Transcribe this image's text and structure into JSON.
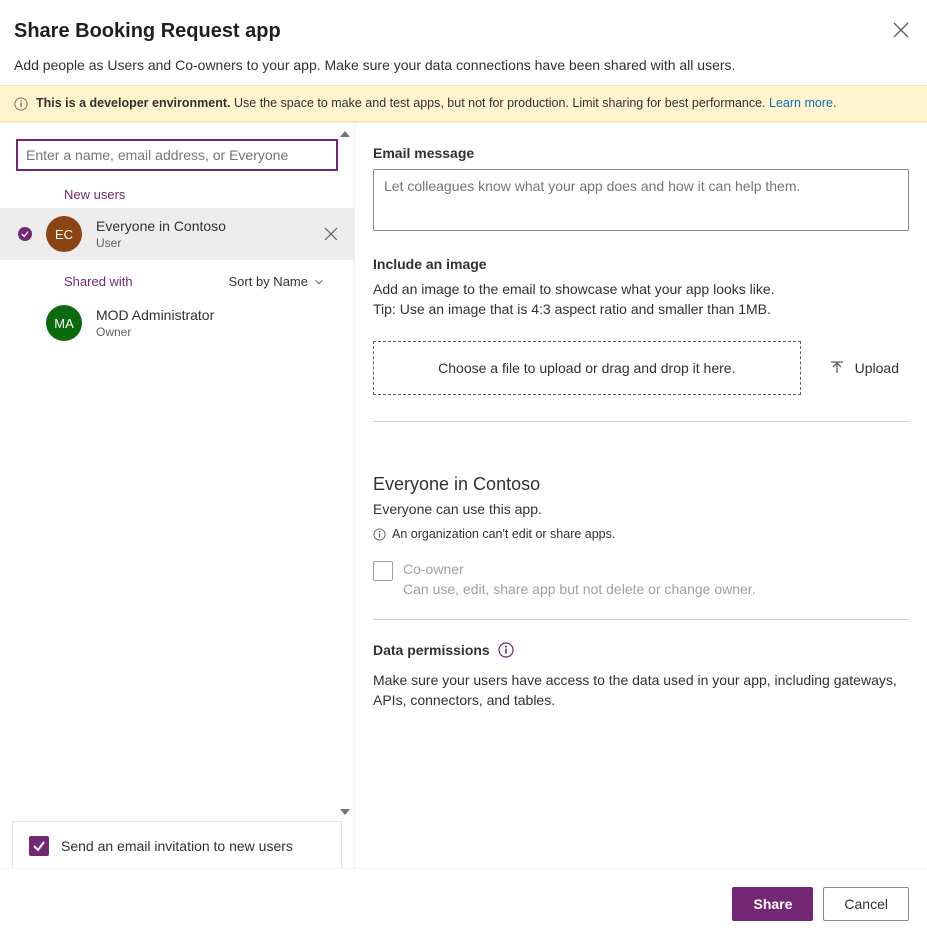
{
  "header": {
    "title": "Share Booking Request app",
    "subtitle": "Add people as Users and Co-owners to your app. Make sure your data connections have been shared with all users."
  },
  "banner": {
    "bold": "This is a developer environment.",
    "text": " Use the space to make and test apps, but not for production. Limit sharing for best performance.  ",
    "link": "Learn more"
  },
  "left": {
    "search_placeholder": "Enter a name, email address, or Everyone",
    "new_users_label": "New users",
    "selected_user": {
      "initials": "EC",
      "name": "Everyone in Contoso",
      "role": "User"
    },
    "shared_with_label": "Shared with",
    "sort_label": "Sort by Name",
    "shared_user": {
      "initials": "MA",
      "name": "MOD Administrator",
      "role": "Owner"
    },
    "send_email_label": "Send an email invitation to new users"
  },
  "right": {
    "email_label": "Email message",
    "email_placeholder": "Let colleagues know what your app does and how it can help them.",
    "image_label": "Include an image",
    "image_desc1": "Add an image to the email to showcase what your app looks like.",
    "image_desc2": "Tip: Use an image that is 4:3 aspect ratio and smaller than 1MB.",
    "dropzone_text": "Choose a file to upload or drag and drop it here.",
    "upload_label": "Upload",
    "perm_title": "Everyone in Contoso",
    "perm_desc": "Everyone can use this app.",
    "perm_note": "An organization can't edit or share apps.",
    "coowner_label": "Co-owner",
    "coowner_desc": "Can use, edit, share app but not delete or change owner.",
    "data_perms_label": "Data permissions",
    "data_perms_body": "Make sure your users have access to the data used in your app, including gateways, APIs, connectors, and tables."
  },
  "footer": {
    "share": "Share",
    "cancel": "Cancel"
  }
}
